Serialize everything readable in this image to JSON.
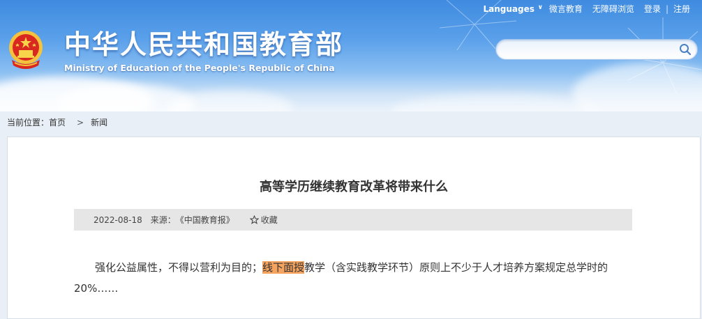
{
  "topnav": {
    "languages": "Languages",
    "weiyan": "微言教育",
    "accessible": "无障碍浏览",
    "login": "登录",
    "register": "注册",
    "separator": "|"
  },
  "site": {
    "title": "中华人民共和国教育部",
    "subtitle": "Ministry of Education of the People's Republic of China"
  },
  "search": {
    "value": "",
    "placeholder": ""
  },
  "breadcrumb": {
    "label": "当前位置：",
    "home": "首页",
    "arrow": ">",
    "current": "新闻"
  },
  "article": {
    "title": "高等学历继续教育改革将带来什么",
    "date": "2022-08-18",
    "source_label": "来源：",
    "source": "《中国教育报》",
    "favorite": "收藏",
    "para_before": "强化公益属性，不得以营利为目的；",
    "para_highlight": "线下面授",
    "para_after": "教学（含实践教学环节）原则上不少于人才培养方案规定总学时的20%……"
  },
  "colors": {
    "highlight": "#f5a460",
    "meta_bar": "#e6e6e6",
    "header_blue": "#3f8be0"
  }
}
